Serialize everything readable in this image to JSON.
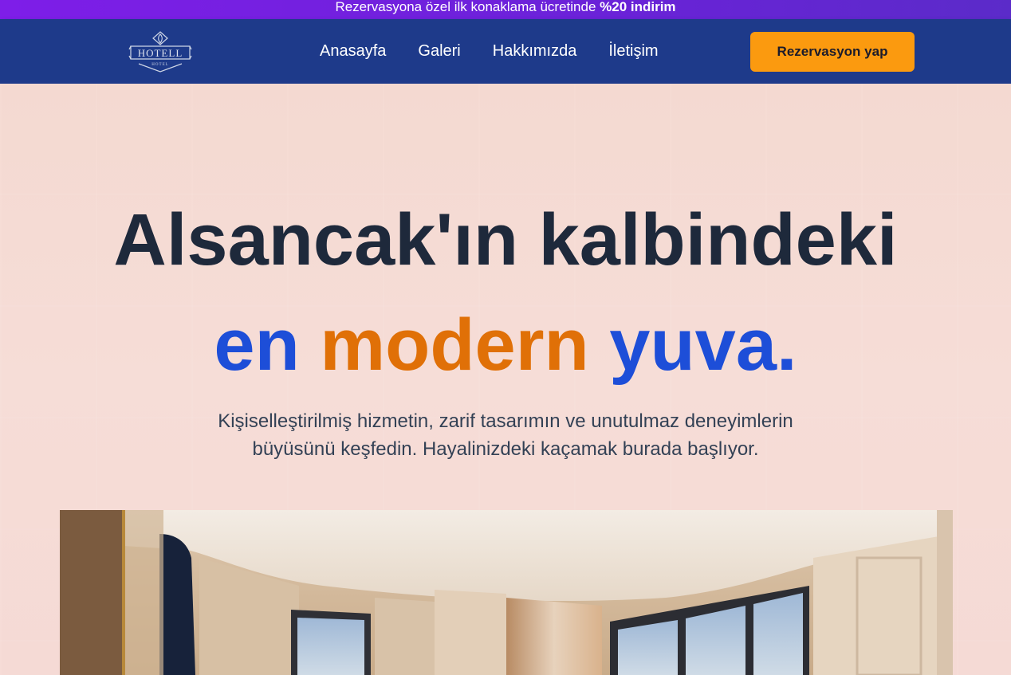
{
  "promo": {
    "text": "Rezervasyona özel ilk konaklama ücretinde ",
    "highlight": "%20 indirim"
  },
  "nav": {
    "logo_text": "HOTELL",
    "logo_sub": "HOTEL",
    "links": [
      "Anasayfa",
      "Galeri",
      "Hakkımızda",
      "İletişim"
    ],
    "cta_label": "Rezervasyon yap"
  },
  "hero": {
    "line1": "Alsancak'ın kalbindeki",
    "line2_part1": "en ",
    "line2_part2": "modern",
    "line2_part3": " yuva",
    "line2_dot": ".",
    "subtitle_line1": "Kişiselleştirilmiş hizmetin, zarif tasarımın ve unutulmaz deneyimlerin",
    "subtitle_line2": "büyüsünü keşfedin. Hayalinizdeki kaçamak burada başlıyor."
  },
  "colors": {
    "promo_bg": "#7e1ee8",
    "nav_bg": "#1e3a8a",
    "cta_bg": "#fb9a0f",
    "accent_blue": "#1d4ed8",
    "accent_orange": "#e07007",
    "hero_bg": "#f6dcd6"
  }
}
